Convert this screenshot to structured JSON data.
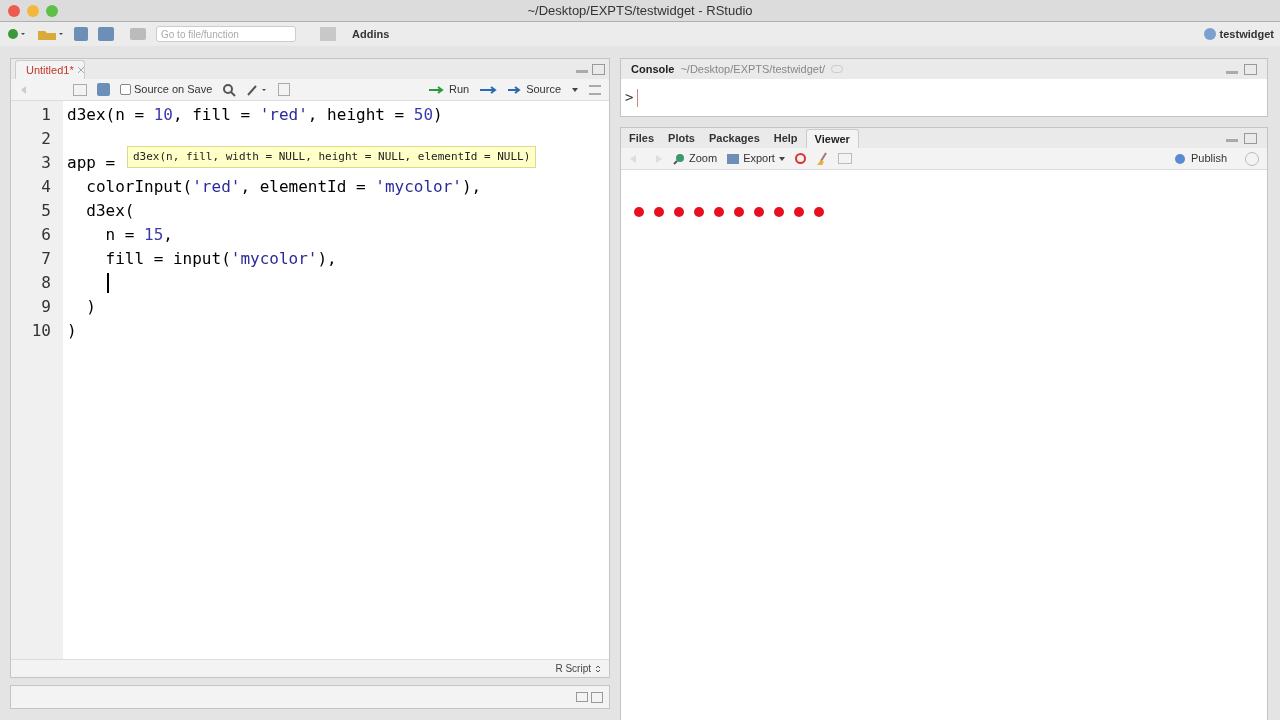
{
  "window": {
    "title": "~/Desktop/EXPTS/testwidget - RStudio"
  },
  "toolbar": {
    "goto_placeholder": "Go to file/function",
    "addins": "Addins",
    "project": "testwidget"
  },
  "editor": {
    "tabs": [
      {
        "label": "Untitled1*",
        "selected": true
      }
    ],
    "toolbar": {
      "source_on_save": {
        "label": "Source on Save",
        "checked": false
      },
      "run": "Run",
      "source": "Source"
    },
    "lines": [
      {
        "number": "1",
        "tokens": [
          {
            "kind": "plain",
            "text": "d3ex(n = "
          },
          {
            "kind": "num",
            "text": "10"
          },
          {
            "kind": "plain",
            "text": ", fill = "
          },
          {
            "kind": "str",
            "text": "'red'"
          },
          {
            "kind": "plain",
            "text": ", height = "
          },
          {
            "kind": "num",
            "text": "50"
          },
          {
            "kind": "plain",
            "text": ")"
          }
        ]
      },
      {
        "number": "2"
      },
      {
        "number": "3",
        "tokens": [
          {
            "kind": "plain",
            "text": "app ="
          }
        ]
      },
      {
        "number": "4",
        "tokens": [
          {
            "kind": "plain",
            "text": "  colorInput("
          },
          {
            "kind": "str",
            "text": "'red'"
          },
          {
            "kind": "plain",
            "text": ", elementId = "
          },
          {
            "kind": "str",
            "text": "'mycolor'"
          },
          {
            "kind": "plain",
            "text": "),"
          }
        ]
      },
      {
        "number": "5",
        "tokens": [
          {
            "kind": "plain",
            "text": "  d3ex("
          }
        ]
      },
      {
        "number": "6",
        "tokens": [
          {
            "kind": "plain",
            "text": "    n = "
          },
          {
            "kind": "num",
            "text": "15"
          },
          {
            "kind": "plain",
            "text": ","
          }
        ]
      },
      {
        "number": "7",
        "tokens": [
          {
            "kind": "plain",
            "text": "    fill = input("
          },
          {
            "kind": "str",
            "text": "'mycolor'"
          },
          {
            "kind": "plain",
            "text": "),"
          }
        ]
      },
      {
        "number": "8",
        "cursor": true
      },
      {
        "number": "9",
        "tokens": [
          {
            "kind": "plain",
            "text": "  )"
          }
        ]
      },
      {
        "number": "10",
        "tokens": [
          {
            "kind": "plain",
            "text": ")"
          }
        ]
      }
    ],
    "tooltip": "d3ex(n, fill, width = NULL, height = NULL, elementId = NULL)",
    "file_type": "R Script"
  },
  "console": {
    "title": "Console",
    "path": "~/Desktop/EXPTS/testwidget/",
    "prompt": ">"
  },
  "viewer_pane": {
    "tabs": [
      {
        "label": "Files",
        "selected": false
      },
      {
        "label": "Plots",
        "selected": false
      },
      {
        "label": "Packages",
        "selected": false
      },
      {
        "label": "Help",
        "selected": false
      },
      {
        "label": "Viewer",
        "selected": true
      }
    ],
    "toolbar": {
      "zoom": "Zoom",
      "export": "Export",
      "publish": "Publish"
    }
  }
}
